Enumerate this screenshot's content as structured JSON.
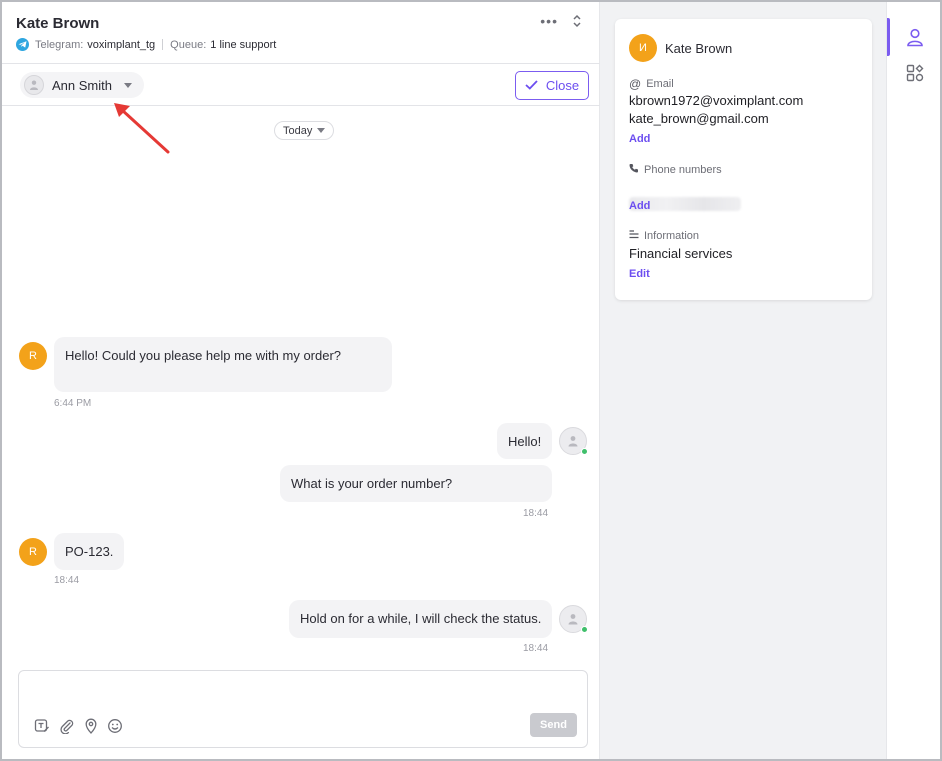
{
  "header": {
    "contact_name": "Kate Brown",
    "channel_label": "Telegram:",
    "channel_value": "voximplant_tg",
    "queue_label": "Queue:",
    "queue_value": "1 line support",
    "more_icon": "more-dots-icon",
    "switch_icon": "chevron-updown-icon"
  },
  "toolbar": {
    "assignee_name": "Ann Smith",
    "close_label": "Close",
    "check_icon": "check-icon"
  },
  "conversation": {
    "day_label": "Today",
    "messages": [
      {
        "from": "client",
        "initial": "R",
        "text": "Hello! Could you please help me with my order?",
        "time": "6:44 PM"
      },
      {
        "from": "operator",
        "text": "Hello!",
        "time": ""
      },
      {
        "from": "operator",
        "text": "What is your order number?",
        "time": "18:44"
      },
      {
        "from": "client",
        "initial": "R",
        "text": "PO-123.",
        "time": "18:44"
      },
      {
        "from": "operator",
        "text": "Hold on for a while, I will check the status.",
        "time": "18:44"
      }
    ]
  },
  "composer": {
    "send_label": "Send",
    "tools": [
      "template-icon",
      "attach-icon",
      "location-icon",
      "emoji-icon"
    ]
  },
  "contact_card": {
    "initial": "И",
    "name": "Kate Brown",
    "email_label": "Email",
    "emails": [
      "kbrown1972@voximplant.com",
      "kate_brown@gmail.com"
    ],
    "email_add": "Add",
    "phone_label": "Phone numbers",
    "phone_add": "Add",
    "info_label": "Information",
    "info_value": "Financial services",
    "info_edit": "Edit"
  },
  "colors": {
    "accent": "#7b5cf0",
    "client_avatar": "#f3a21a",
    "online": "#3fbf6b",
    "telegram": "#2ea6e0"
  }
}
